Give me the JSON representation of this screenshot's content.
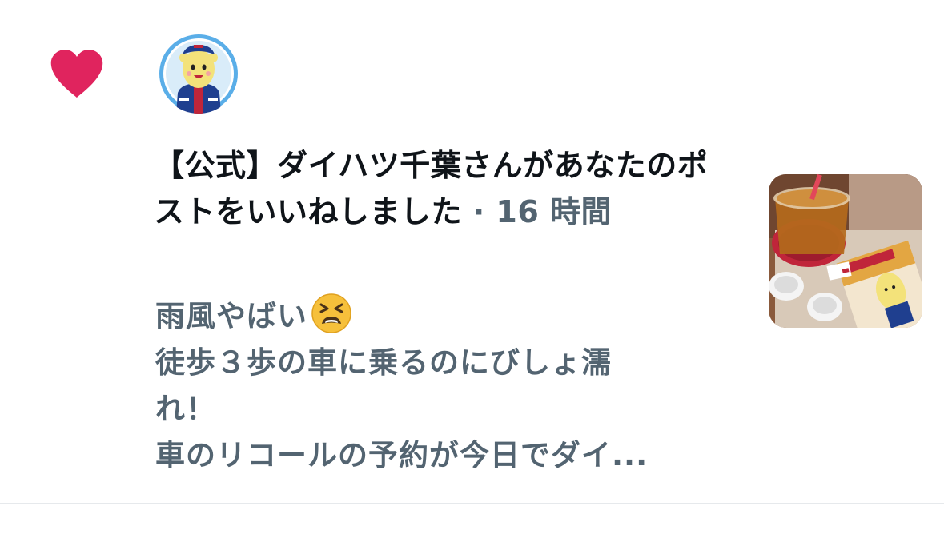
{
  "notification": {
    "icon": "heart-icon",
    "icon_color": "#e0245e",
    "avatar": "mascot-avatar",
    "avatar_ring_color": "#5aaee8",
    "actor": "【公式】ダイハツ千葉さん",
    "action": "があなたのポストをいいねしました",
    "separator": " · ",
    "time": "16 時間",
    "post_lines": [
      "雨風やばい",
      "徒歩３歩の車に乗るのにびしょ濡",
      "れ！",
      "車のリコールの予約が今日でダイ..."
    ],
    "post_emoji": "tired-face-emoji",
    "thumbnail": "iced-tea-and-snack-photo"
  },
  "colors": {
    "primary_text": "#0f1419",
    "secondary_text": "#536471",
    "divider": "#e6e9ec"
  }
}
